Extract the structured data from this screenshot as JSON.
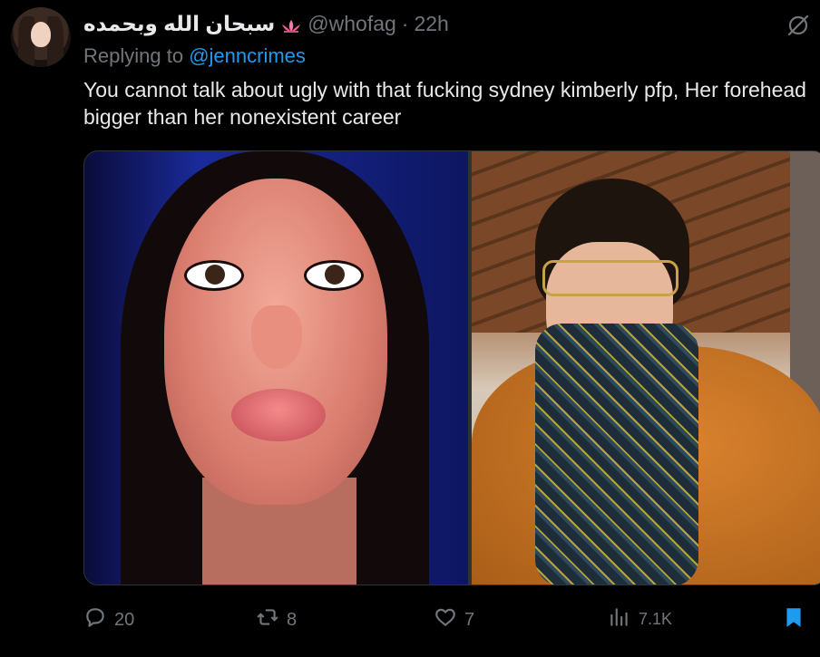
{
  "tweet": {
    "display_name": "سبحان الله وبحمده",
    "handle": "@whofag",
    "dot": "·",
    "time": "22h",
    "reply_prefix": "Replying to",
    "reply_to": "@jenncrimes",
    "text": "You cannot talk about ugly with that fucking sydney kimberly pfp, Her forehead bigger than her nonexistent career"
  },
  "actions": {
    "replies": "20",
    "retweets": "8",
    "likes": "7",
    "views": "7.1K"
  },
  "colors": {
    "background": "#000000",
    "text": "#e7e9ea",
    "muted": "#71767b",
    "accent": "#1d9bf0",
    "border": "#2f3336"
  },
  "icons": {
    "avatar": "profile-photo",
    "name_emoji": "lotus-icon",
    "grok": "grok-slash-icon",
    "reply": "reply-icon",
    "retweet": "retweet-icon",
    "like": "heart-icon",
    "views": "analytics-icon",
    "bookmark": "bookmark-icon"
  }
}
